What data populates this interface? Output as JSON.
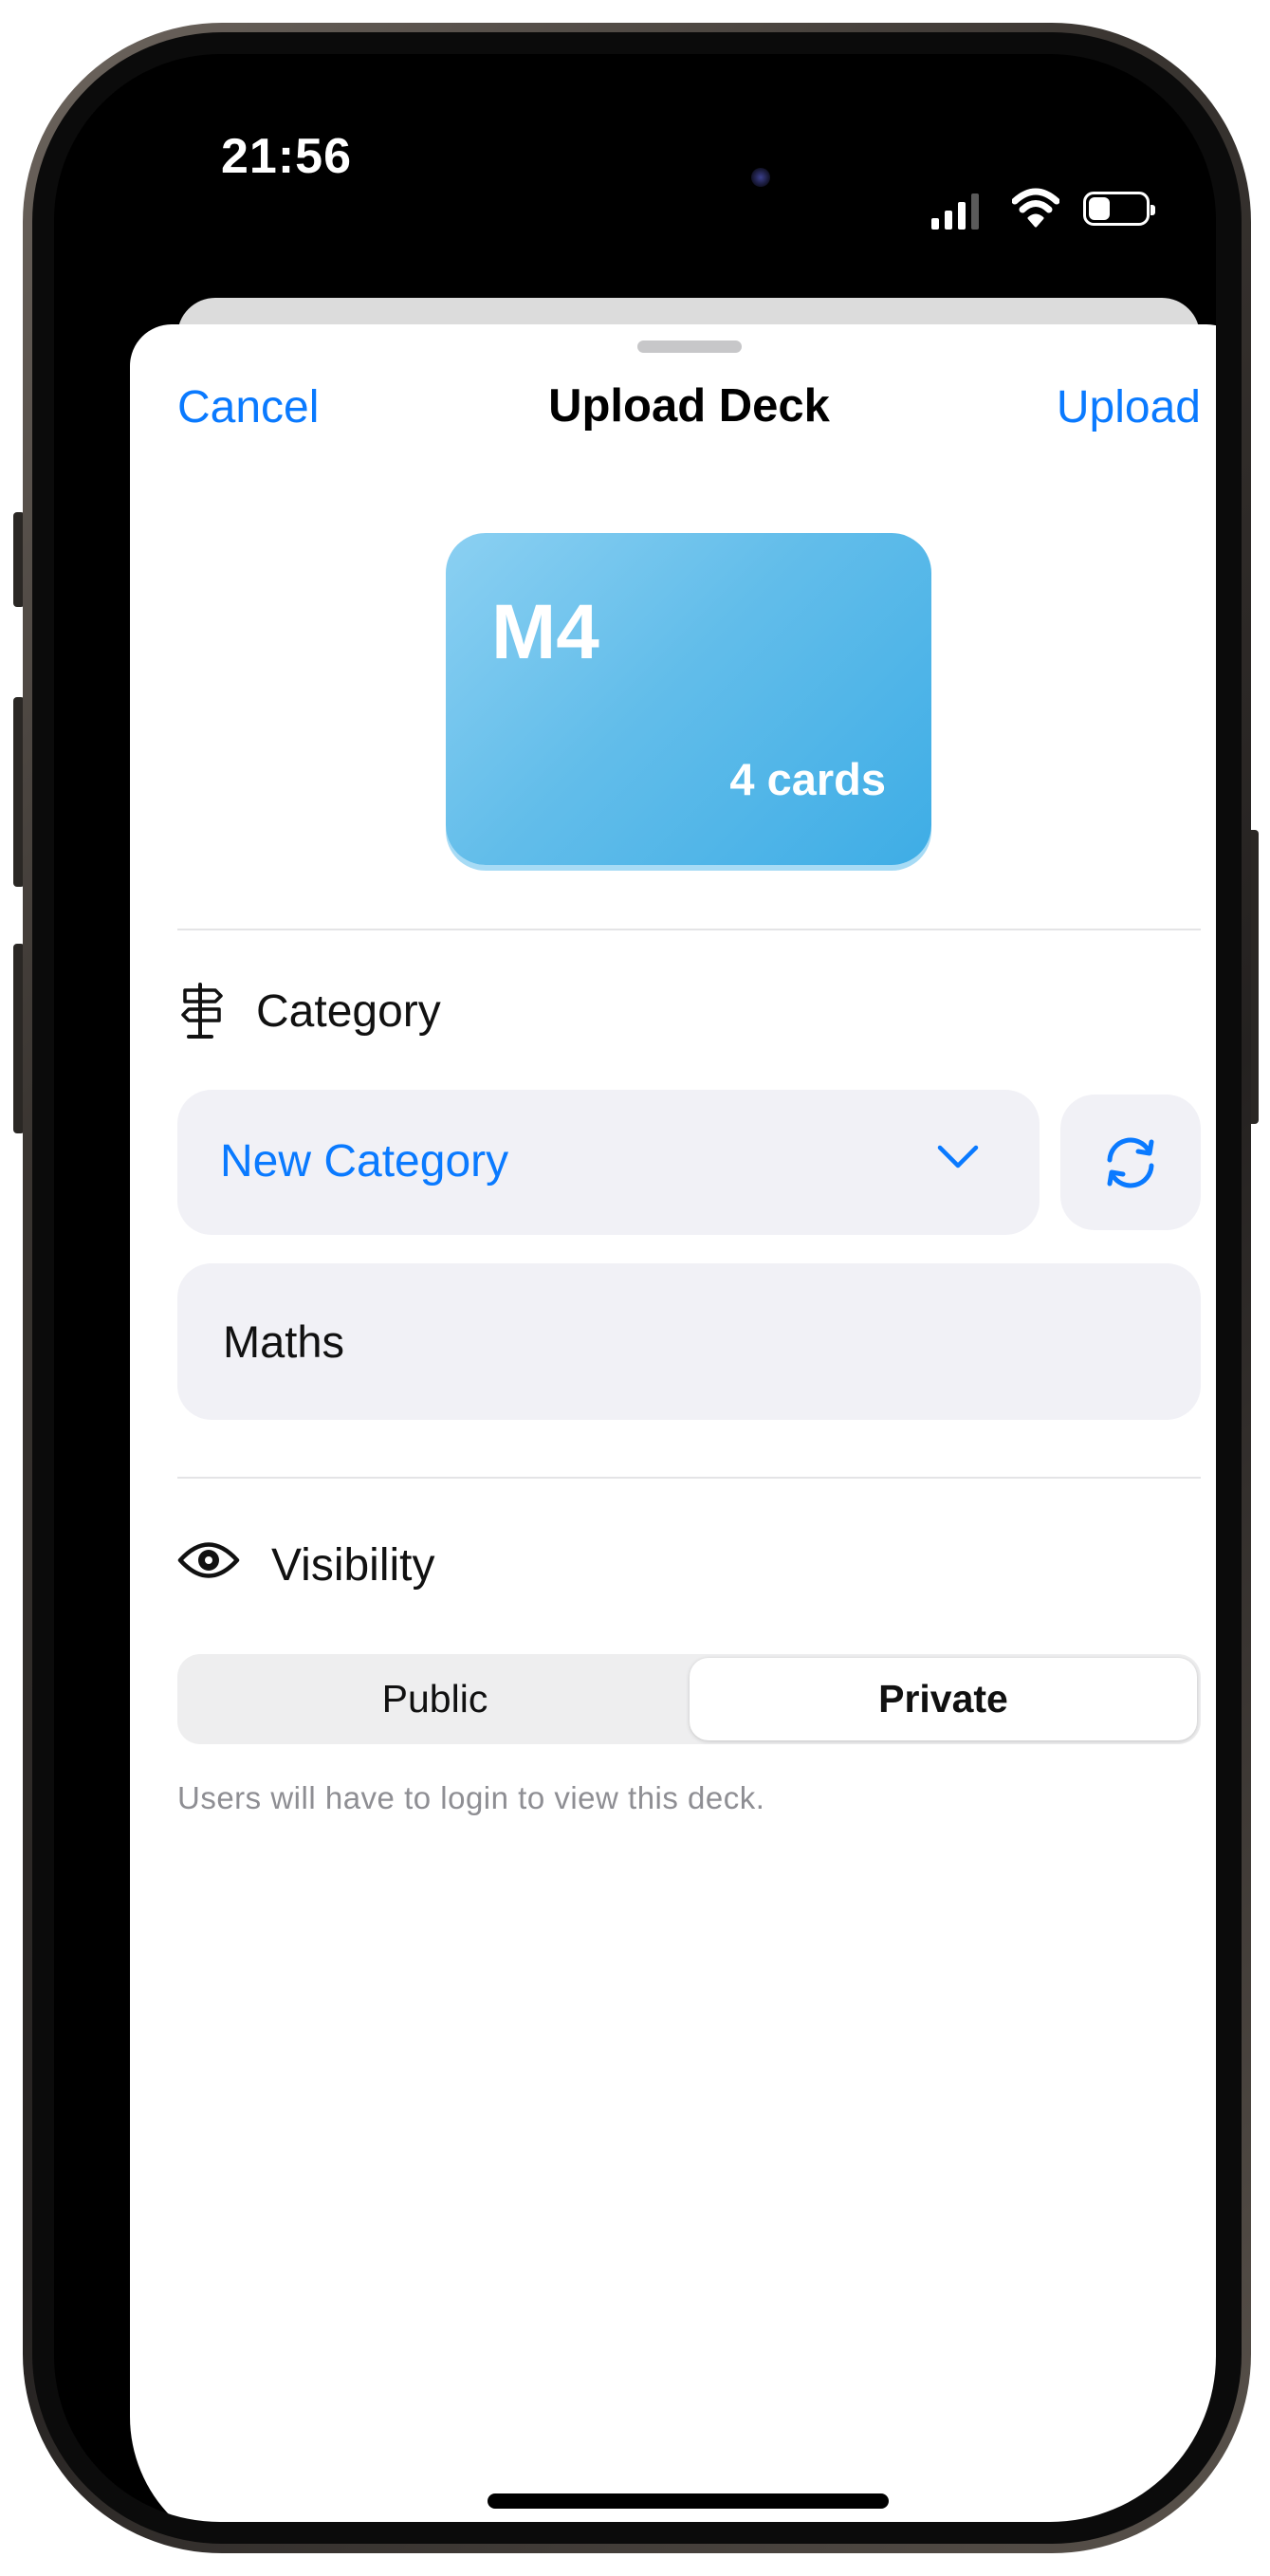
{
  "status_bar": {
    "time": "21:56",
    "signal_bars": 3,
    "battery_level": 0.25
  },
  "nav": {
    "cancel_label": "Cancel",
    "title": "Upload Deck",
    "upload_label": "Upload"
  },
  "deck": {
    "name": "M4",
    "count_label": "4 cards",
    "color": "#5bbbea"
  },
  "category": {
    "label": "Category",
    "icon": "signpost-icon",
    "selected": "New Category",
    "name_value": "Maths"
  },
  "visibility": {
    "label": "Visibility",
    "icon": "eye-icon",
    "options": [
      "Public",
      "Private"
    ],
    "selected": "Private",
    "hint": "Users will have to login to view this deck."
  },
  "colors": {
    "accent": "#0a7aff",
    "field_bg": "#f1f1f6",
    "hint": "#8e8e93"
  }
}
